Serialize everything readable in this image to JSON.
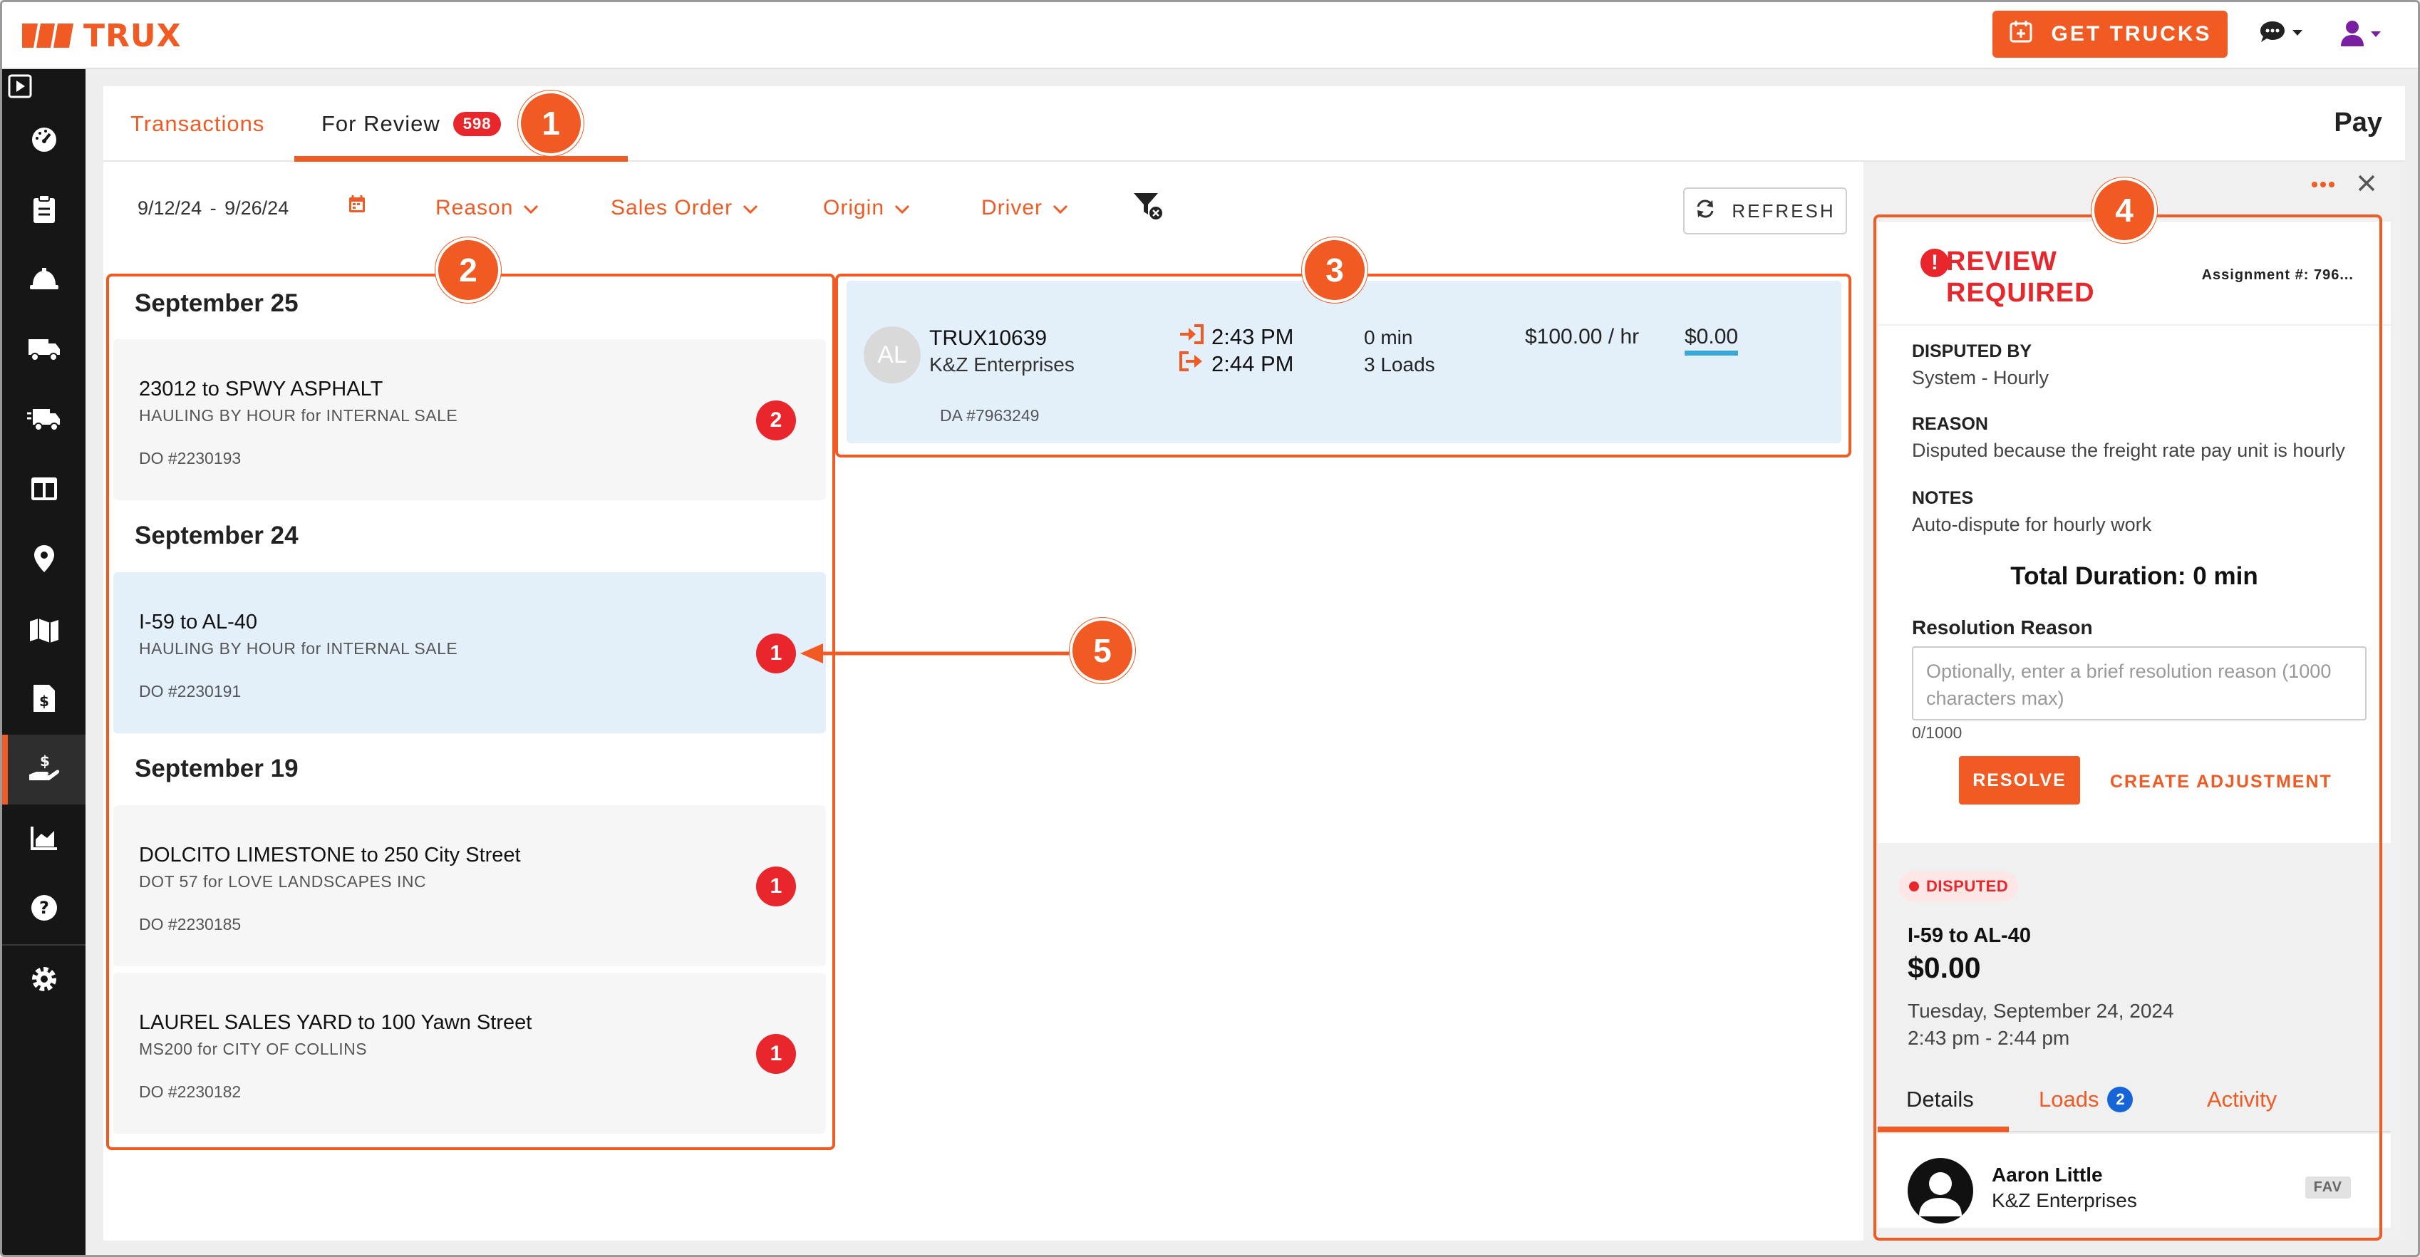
{
  "app": {
    "logo_text": "TRUX",
    "brand_color": "#f15a22",
    "get_trucks_label": "GET TRUCKS"
  },
  "tabs": {
    "transactions": "Transactions",
    "for_review": "For Review",
    "for_review_count": "598",
    "page_title": "Pay"
  },
  "filters": {
    "date_start": "9/12/24",
    "date_sep": "-",
    "date_end": "9/26/24",
    "reason": "Reason",
    "sales_order": "Sales Order",
    "origin": "Origin",
    "driver": "Driver",
    "refresh": "REFRESH"
  },
  "orders": {
    "groups": [
      {
        "date": "September 25"
      },
      {
        "date": "September 24"
      },
      {
        "date": "September 19"
      }
    ],
    "items": [
      {
        "title": "23012 to SPWY ASPHALT",
        "subtitle": "HAULING BY HOUR for INTERNAL SALE",
        "do": "DO #2230193",
        "count": "2"
      },
      {
        "title": "I-59 to AL-40",
        "subtitle": "HAULING BY HOUR for INTERNAL SALE",
        "do": "DO #2230191",
        "count": "1"
      },
      {
        "title": "DOLCITO LIMESTONE to 250 City Street",
        "subtitle": "DOT 57 for LOVE LANDSCAPES INC",
        "do": "DO #2230185",
        "count": "1"
      },
      {
        "title": "LAUREL SALES YARD to 100 Yawn Street",
        "subtitle": "MS200 for CITY OF COLLINS",
        "do": "DO #2230182",
        "count": "1"
      }
    ]
  },
  "assignment": {
    "initials": "AL",
    "truck_id": "TRUX10639",
    "company": "K&Z Enterprises",
    "da": "DA #7963249",
    "time_in": "2:43 PM",
    "time_out": "2:44 PM",
    "duration": "0 min",
    "loads": "3 Loads",
    "rate": "$100.00 / hr",
    "amount": "$0.00"
  },
  "review": {
    "title_line1": "REVIEW",
    "title_line2": "REQUIRED",
    "assignment_no": "Assignment #: 796...",
    "disputed_by_label": "DISPUTED BY",
    "disputed_by_value": "System - Hourly",
    "reason_label": "REASON",
    "reason_value": "Disputed because the freight rate pay unit is hourly",
    "notes_label": "NOTES",
    "notes_value": "Auto-dispute for hourly work",
    "total_duration": "Total Duration: 0 min",
    "resolution_label": "Resolution Reason",
    "resolution_placeholder": "Optionally, enter a brief resolution reason (1000 characters max)",
    "char_count": "0/1000",
    "resolve_label": "RESOLVE",
    "adjust_label": "CREATE ADJUSTMENT"
  },
  "detail": {
    "status": "DISPUTED",
    "route": "I-59 to AL-40",
    "amount": "$0.00",
    "date": "Tuesday, September 24, 2024",
    "time_range": "2:43 pm - 2:44 pm",
    "tab_details": "Details",
    "tab_loads": "Loads",
    "tab_loads_count": "2",
    "tab_activity": "Activity",
    "driver_name": "Aaron Little",
    "driver_company": "K&Z Enterprises",
    "fav_label": "FAV"
  },
  "annotations": [
    "1",
    "2",
    "3",
    "4",
    "5"
  ]
}
